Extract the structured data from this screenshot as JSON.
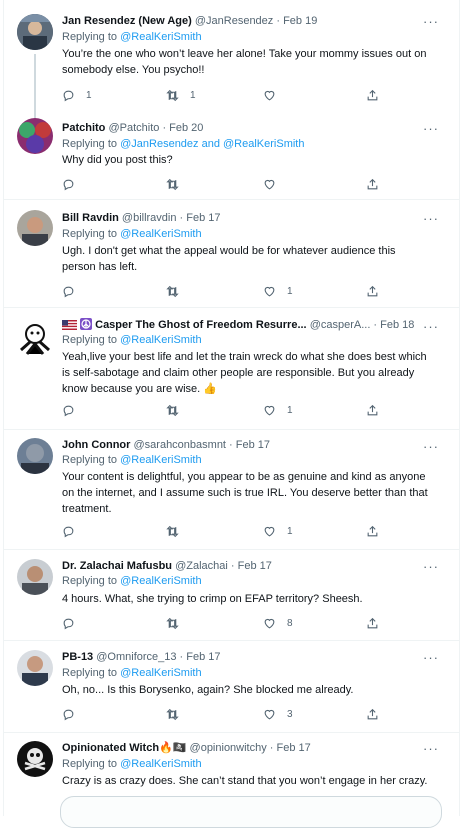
{
  "tweets": [
    {
      "name": "Jan Resendez (New Age)",
      "meta": "@JanResendez · Feb 19",
      "replying_prefix": "Replying to",
      "replying_to": "@RealKeriSmith",
      "text": [
        "You’re the one who won’t leave her alone! Take your mommy issues out on",
        "somebody else. You psycho!!"
      ],
      "replies": "1",
      "retweets": "1",
      "likes": ""
    },
    {
      "name": "Patchito",
      "meta": "@Patchito · Feb 20",
      "replying_prefix": "Replying to",
      "replying_to": "@JanResendez and @RealKeriSmith",
      "text": [
        "Why did you post this?"
      ],
      "replies": "",
      "retweets": "",
      "likes": ""
    },
    {
      "name": "Bill Ravdin",
      "meta": "@billravdin · Feb 17",
      "replying_prefix": "Replying to",
      "replying_to": "@RealKeriSmith",
      "text": [
        "Ugh. I don't get what the appeal would be for whatever audience this",
        "person has left."
      ],
      "replies": "",
      "retweets": "",
      "likes": "1"
    },
    {
      "name": "Casper The Ghost of Freedom Resurre...",
      "meta": "@casperA... · Feb 18",
      "replying_prefix": "Replying to",
      "replying_to": "@RealKeriSmith",
      "text": [
        "Yeah,live your best life and let the train wreck do what she does best which",
        "is self-sabotage and claim other people are responsible. But you already",
        "know because you are wise. 👍"
      ],
      "replies": "",
      "retweets": "",
      "likes": "1"
    },
    {
      "name": "John Connor",
      "meta": "@sarahconbasmnt · Feb 17",
      "replying_prefix": "Replying to",
      "replying_to": "@RealKeriSmith",
      "text": [
        "Your content is delightful, you appear to be as genuine and kind as anyone",
        "on the internet, and I assume such is true IRL. You deserve better than that",
        "treatment."
      ],
      "replies": "",
      "retweets": "",
      "likes": "1"
    },
    {
      "name": "Dr. Zalachai Mafusbu",
      "meta": "@Zalachai · Feb 17",
      "replying_prefix": "Replying to",
      "replying_to": "@RealKeriSmith",
      "text": [
        "4 hours. What, she trying to crimp on EFAP territory? Sheesh."
      ],
      "replies": "",
      "retweets": "",
      "likes": "8"
    },
    {
      "name": "PB-13",
      "meta": "@Omniforce_13 · Feb 17",
      "replying_prefix": "Replying to",
      "replying_to": "@RealKeriSmith",
      "text": [
        "Oh, no... Is this Borysenko, again? She blocked me already."
      ],
      "replies": "",
      "retweets": "",
      "likes": "3"
    },
    {
      "name": "Opinionated Witch🔥🏴‍☠️",
      "meta": "@opinionwitchy · Feb 17",
      "replying_prefix": "Replying to",
      "replying_to": "@RealKeriSmith",
      "text": [
        "Crazy is as crazy does. She can’t stand that you won’t engage in her crazy."
      ],
      "replies": "",
      "retweets": "",
      "likes": ""
    }
  ],
  "icons": {
    "reply": "reply-icon",
    "retweet": "retweet-icon",
    "like": "heart-icon",
    "share": "share-icon",
    "more": "more-icon"
  },
  "colors": {
    "link": "#1d9bf0",
    "muted": "#536471",
    "border": "#eff3f4"
  }
}
